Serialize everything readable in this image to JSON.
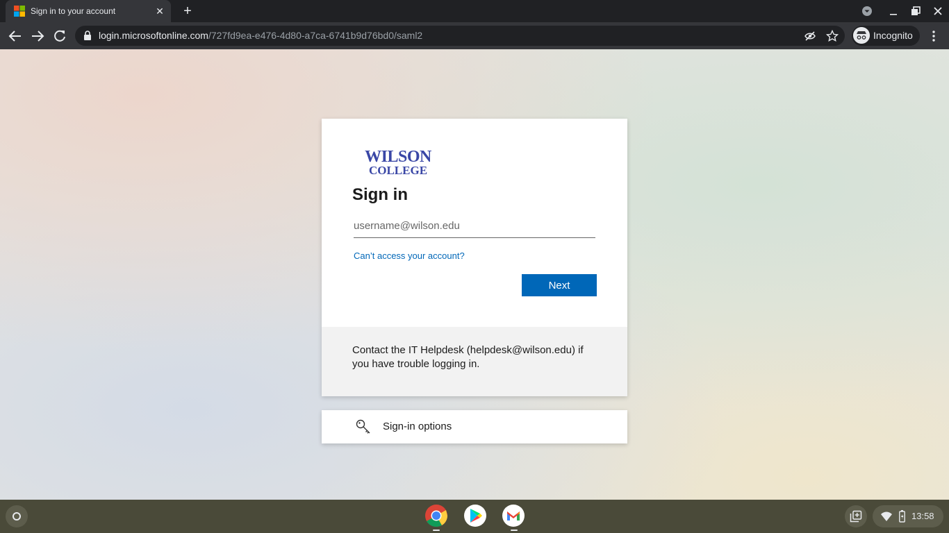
{
  "browser": {
    "tab_title": "Sign in to your account",
    "new_tab_glyph": "+",
    "close_glyph": "✕",
    "url_host": "login.microsoftonline.com",
    "url_path": "/727fd9ea-e476-4d80-a7ca-6741b9d76bd0/saml2",
    "incognito_label": "Incognito"
  },
  "signin": {
    "logo_line1": "WILSON",
    "logo_line2": "COLLEGE",
    "title": "Sign in",
    "email_placeholder": "username@wilson.edu",
    "email_value": "",
    "cant_access": "Can’t access your account?",
    "next_label": "Next",
    "help_text": "Contact the IT Helpdesk (helpdesk@wilson.edu) if you have trouble logging in.",
    "options_label": "Sign-in options"
  },
  "shelf": {
    "apps": [
      "chrome-icon",
      "play-store-icon",
      "gmail-icon"
    ],
    "time": "13:58"
  },
  "colors": {
    "accent": "#0067b8",
    "logo": "#3a47a6",
    "chrome_dark": "#202124",
    "toolbar": "#35363a"
  }
}
